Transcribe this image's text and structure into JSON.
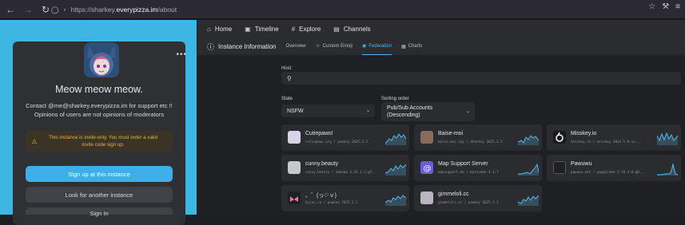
{
  "browser": {
    "url_prefix": "https://sharkey.",
    "url_domain": "everypizza.im",
    "url_suffix": "/about"
  },
  "profile": {
    "title": "Meow meow meow.",
    "desc_line1": "Contact @me@sharkey.everypizza.im for support etc !!",
    "desc_line2": "Opinions of users are not opinions of moderators",
    "warning_line1": "This instance is invite-only. You must enter a valid",
    "warning_line2": "invite code sign up.",
    "signup_label": "Sign up at this instance",
    "look_label": "Look for another instance",
    "signin_label": "Sign In"
  },
  "nav": {
    "home": "Home",
    "timeline": "Timeline",
    "explore": "Explore",
    "channels": "Channels"
  },
  "page": {
    "title": "Instance Information",
    "tabs": [
      "Overview",
      "Custom Emoji",
      "Federation",
      "Charts"
    ]
  },
  "filters": {
    "host_label": "Host",
    "state_label": "State",
    "state_value": "NSFW",
    "sort_label": "Sorting order",
    "sort_value_line1": "Pub/Sub Accounts",
    "sort_value_line2": "(Descending)"
  },
  "instances": [
    {
      "name": "Cutiepaws!",
      "meta": "cutiepaws.org / pawkey 2025.2.2"
    },
    {
      "name": "Baise-moi",
      "meta": "baise-moi.top / Sharkey 2025.2.2"
    },
    {
      "name": "Misskey.io",
      "meta": "misskey.io / misskey 2024.5.0-io..."
    },
    {
      "name": "cunny.beauty",
      "meta": "cunny.beauty / akkoma 3.14.1-2-g5..."
    },
    {
      "name": "Map Support Server",
      "meta": "mapsupport.de / mastodon 4.3.7"
    },
    {
      "name": "Pawuwu",
      "meta": "pawuwu.net / poppyrome 3.10.4-0-g0..."
    },
    {
      "name": "、゛(っ♡ｖ)",
      "meta": "kojai.ca / pawkey 2025.2.2"
    },
    {
      "name": "gimmeloli.cc",
      "meta": "gimmeloli.cc / pawkey 2025.2.2"
    }
  ],
  "colors": {
    "left_bg": "#3eb6e3",
    "accent": "#58b8ec",
    "warning": "#e3b34a"
  }
}
